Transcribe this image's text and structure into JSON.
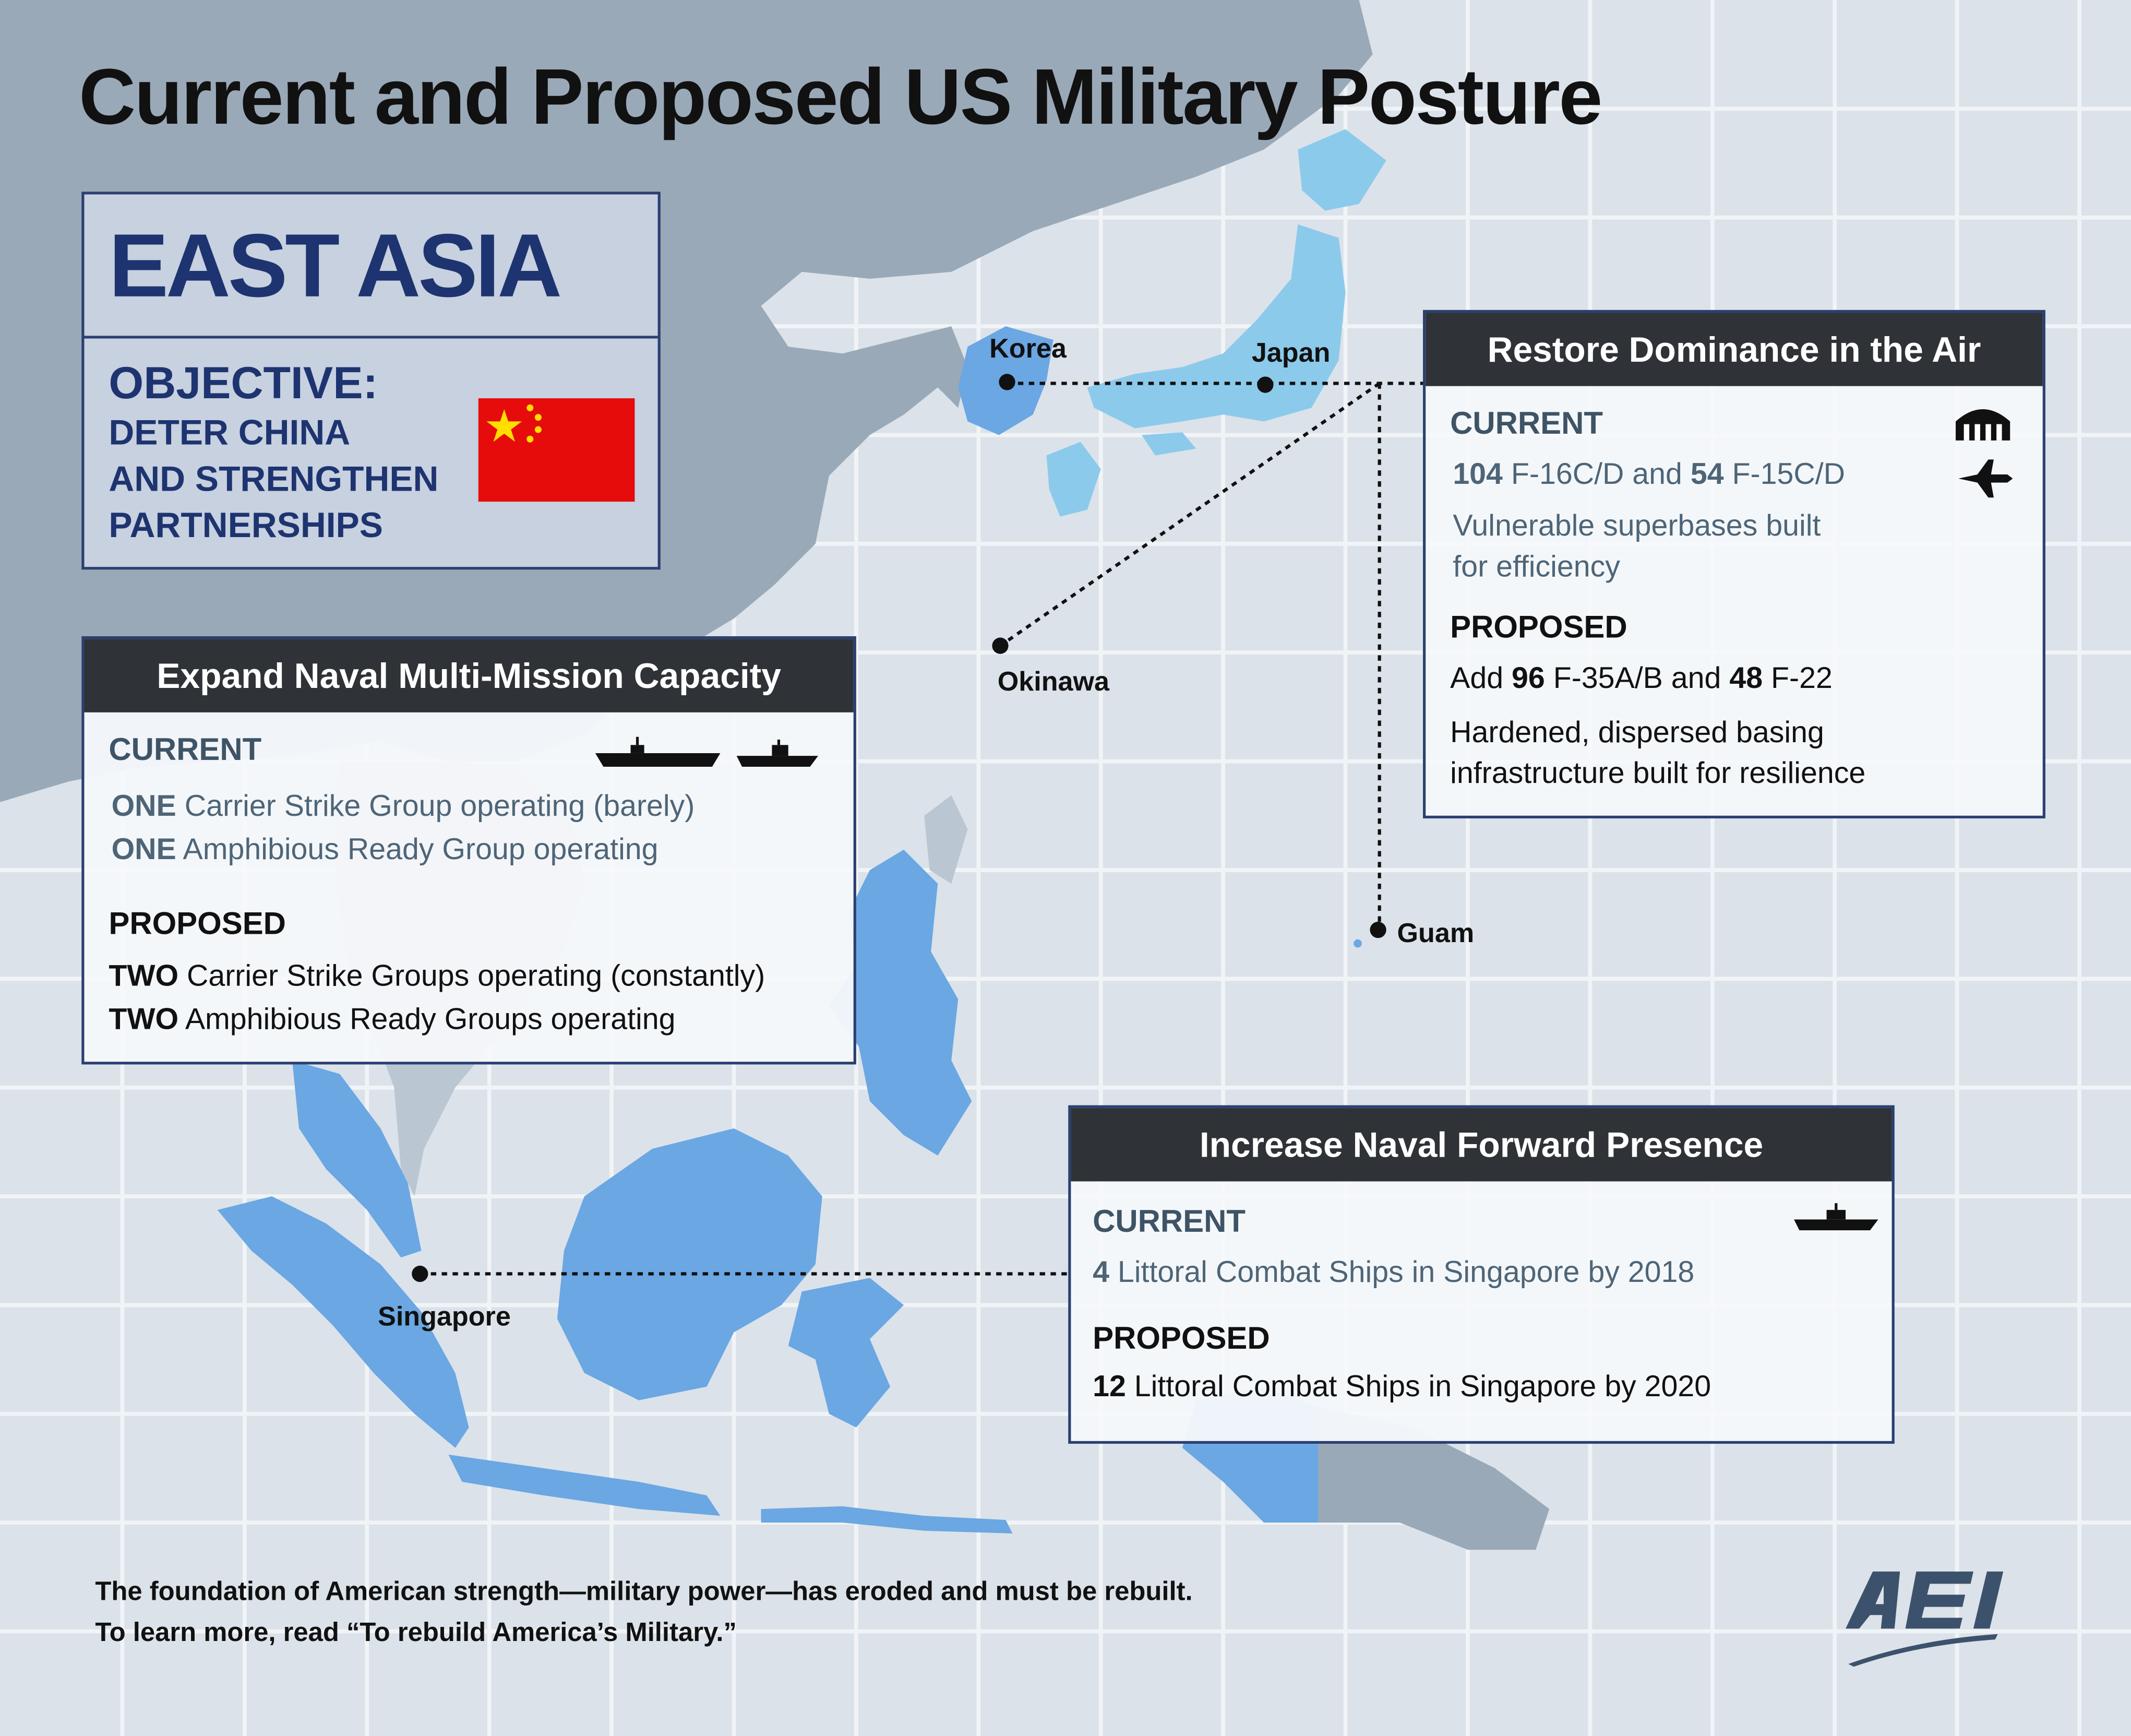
{
  "title": "Current and Proposed US Military Posture",
  "region": {
    "name": "EAST ASIA",
    "objective_label": "OBJECTIVE:",
    "objective_lines": [
      "DETER CHINA",
      "AND STRENGTHEN",
      "PARTNERSHIPS"
    ],
    "flag_icon": "china-flag-icon"
  },
  "places": {
    "korea": "Korea",
    "japan": "Japan",
    "okinawa": "Okinawa",
    "guam": "Guam",
    "singapore": "Singapore"
  },
  "air_panel": {
    "header": "Restore Dominance in the Air",
    "current_label": "CURRENT",
    "current_line1": {
      "n1": "104",
      "t1": " F-16C/D and ",
      "n2": "54",
      "t2": " F-15C/D"
    },
    "current_note": [
      "Vulnerable superbases built",
      "for efficiency"
    ],
    "proposed_label": "PROPOSED",
    "proposed_line1": {
      "t0": "Add ",
      "n1": "96",
      "t1": " F-35A/B and ",
      "n2": "48",
      "t2": " F-22"
    },
    "proposed_note": [
      "Hardened, dispersed basing",
      "infrastructure built for resilience"
    ],
    "icons": [
      "hangar-icon",
      "fighter-jet-icon"
    ]
  },
  "naval_mission_panel": {
    "header": "Expand Naval Multi-Mission Capacity",
    "current_label": "CURRENT",
    "current_lines": [
      {
        "n": "ONE",
        "t": " Carrier Strike Group operating (barely)"
      },
      {
        "n": "ONE",
        "t": " Amphibious Ready Group operating"
      }
    ],
    "proposed_label": "PROPOSED",
    "proposed_lines": [
      {
        "n": "TWO",
        "t": " Carrier Strike Groups operating (constantly)"
      },
      {
        "n": "TWO",
        "t": " Amphibious Ready Groups operating"
      }
    ],
    "icons": [
      "aircraft-carrier-icon",
      "amphibious-ship-icon"
    ]
  },
  "naval_forward_panel": {
    "header": "Increase Naval Forward Presence",
    "current_label": "CURRENT",
    "current_line": {
      "n": "4",
      "t": " Littoral Combat Ships in Singapore by 2018"
    },
    "proposed_label": "PROPOSED",
    "proposed_line": {
      "n": "12",
      "t": " Littoral Combat Ships in Singapore by 2020"
    },
    "icons": [
      "combat-ship-icon"
    ]
  },
  "footer": [
    "The foundation of American strength—military power—has eroded and must be rebuilt.",
    "To learn more, read “To rebuild America’s Military.”"
  ],
  "logo": "AEI",
  "colors": {
    "ocean": "#dbe2e9",
    "mainland": "#9aa9b8",
    "highlight_land": "#6aa7e3",
    "japan_land": "#8ccaeb",
    "navy": "#1e3470",
    "panel_header": "#2f3236",
    "flag_red": "#e60c0c",
    "flag_star": "#ffde00"
  }
}
